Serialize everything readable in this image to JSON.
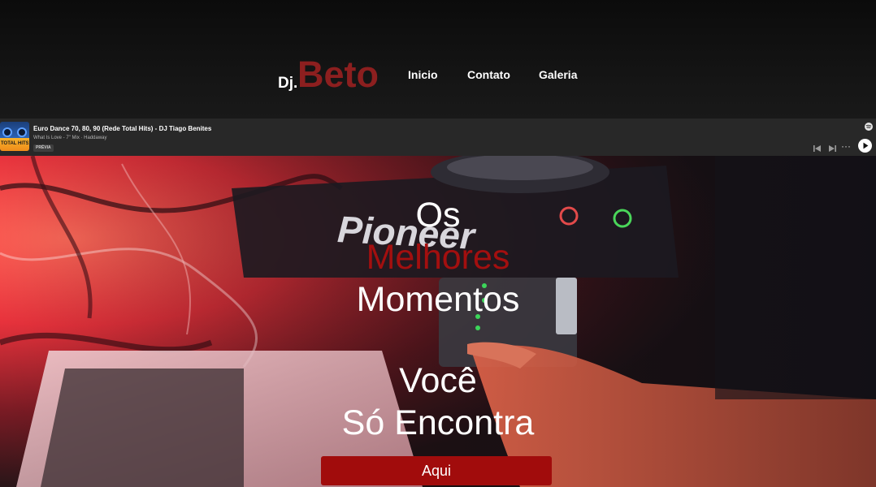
{
  "header": {
    "logo_prefix": "Dj.",
    "logo_name": "Beto",
    "nav": [
      {
        "label": "Inicio"
      },
      {
        "label": "Contato"
      },
      {
        "label": "Galeria"
      }
    ]
  },
  "player": {
    "cover_text": "TOTAL HITS",
    "title": "Euro Dance 70, 80, 90 (Rede Total Hits) - DJ Tiago Benites",
    "subtitle": "What Is Love - 7\" Mix · Haddaway",
    "badge": "PRÉVIA",
    "more": "···",
    "icons": [
      "spotify-logo-icon",
      "previous-icon",
      "next-icon",
      "more-icon",
      "play-icon"
    ]
  },
  "hero": {
    "lines": [
      "Os",
      "Melhores",
      "Momentos",
      "Você",
      "Só Encontra"
    ],
    "cta": "Aqui"
  },
  "colors": {
    "brand": "#8c1f1f",
    "highlight": "#a30f0f",
    "button": "#a10c0c",
    "player_bg": "#282828"
  }
}
